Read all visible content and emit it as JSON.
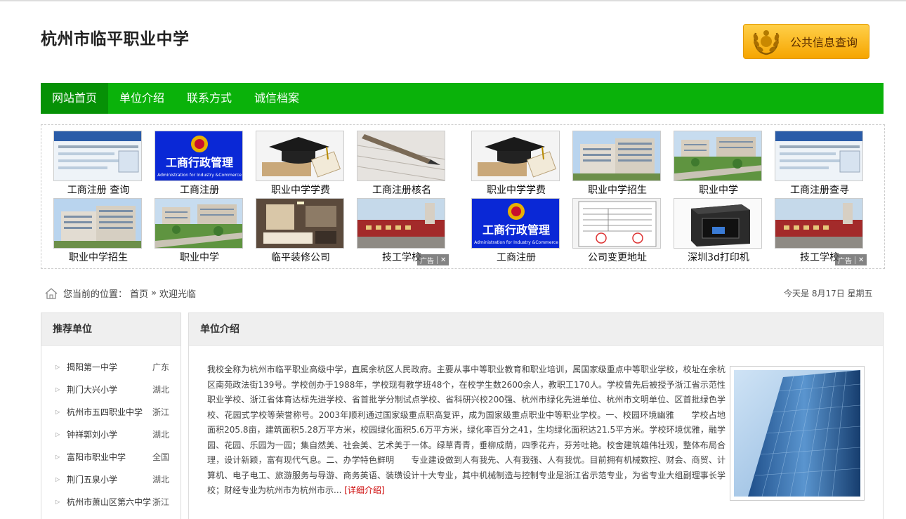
{
  "site": {
    "title": "杭州市临平职业中学",
    "query_button": "公共信息查询"
  },
  "nav": {
    "items": [
      "网站首页",
      "单位介绍",
      "联系方式",
      "诚信档案"
    ]
  },
  "ads": {
    "row1": [
      "工商注册 查询",
      "工商注册",
      "职业中学学费",
      "工商注册核名",
      "职业中学学费",
      "职业中学招生",
      "职业中学",
      "工商注册查寻"
    ],
    "row2": [
      "职业中学招生",
      "职业中学",
      "临平装修公司",
      "技工学校",
      "工商注册",
      "公司变更地址",
      "深圳3d打印机",
      "技工学校"
    ],
    "tag": "广告",
    "close": "✕"
  },
  "breadcrumb": {
    "prefix": "您当前的位置：",
    "home": "首页",
    "sep": "»",
    "current": "欢迎光临"
  },
  "date": "今天是 8月17日 星期五",
  "recommend": {
    "title": "推荐单位",
    "items": [
      {
        "name": "揭阳第一中学",
        "prov": "广东"
      },
      {
        "name": "荆门大兴小学",
        "prov": "湖北"
      },
      {
        "name": "杭州市五四职业中学",
        "prov": "浙江"
      },
      {
        "name": "钟祥郭刘小学",
        "prov": "湖北"
      },
      {
        "name": "富阳市职业中学",
        "prov": "全国"
      },
      {
        "name": "荆门五泉小学",
        "prov": "湖北"
      },
      {
        "name": "杭州市萧山区第六中学",
        "prov": "浙江"
      }
    ]
  },
  "intro": {
    "title": "单位介绍",
    "text": "我校全称为杭州市临平职业高级中学，直属余杭区人民政府。主要从事中等职业教育和职业培训，属国家级重点中等职业学校，校址在余杭区南苑政法街139号。学校创办于1988年，学校现有教学班48个，在校学生数2600余人，教职工170人。学校曾先后被授予浙江省示范性职业学校、浙江省体育达标先进学校、省首批学分制试点学校、省科研兴校200强、杭州市绿化先进单位、杭州市文明单位、区首批绿色学校、花园式学校等荣誉称号。2003年顺利通过国家级重点职高复评，成为国家级重点职业中等职业学校。一、校园环境幽雅　　学校占地面积205.8亩，建筑面积5.28万平方米，校园绿化面积5.6万平方米，绿化率百分之41，生均绿化面积达21.5平方米。学校环境优雅，融学园、花园、乐园为一园；集自然美、社会美、艺术美于一体。绿草青青，垂柳成荫，四季花卉，芬芳吐艳。校舍建筑雄伟壮观，整体布局合理，设计新颖，富有现代气息。二、办学特色鲜明　　专业建设做到人有我先、人有我强、人有我优。目前拥有机械数控、财会、商贸、计算机、电子电工、旅游服务与导游、商务英语、装璜设计十大专业，其中机械制造与控制专业是浙江省示范专业，为省专业大组副理事长学校；财经专业为杭州市为杭州市示...",
    "more": "[详细介绍]"
  },
  "colors": {
    "nav_green": "#0ab20a",
    "nav_active": "#069106",
    "button_gold": "#f6a500",
    "link_red": "#cc0000"
  }
}
